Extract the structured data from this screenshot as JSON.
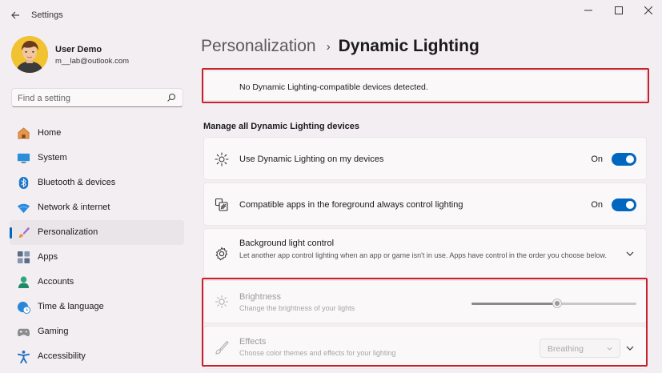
{
  "window": {
    "title": "Settings",
    "back_icon": "back-arrow-icon",
    "controls": [
      "minimize-icon",
      "maximize-icon",
      "close-icon"
    ]
  },
  "profile": {
    "name": "User Demo",
    "email": "m__lab@outlook.com"
  },
  "search": {
    "placeholder": "Find a setting",
    "icon": "search-icon"
  },
  "sidebar": {
    "items": [
      {
        "label": "Home",
        "icon": "home-icon",
        "active": false
      },
      {
        "label": "System",
        "icon": "system-icon",
        "active": false
      },
      {
        "label": "Bluetooth & devices",
        "icon": "bluetooth-icon",
        "active": false
      },
      {
        "label": "Network & internet",
        "icon": "network-icon",
        "active": false
      },
      {
        "label": "Personalization",
        "icon": "brush-icon",
        "active": true
      },
      {
        "label": "Apps",
        "icon": "apps-icon",
        "active": false
      },
      {
        "label": "Accounts",
        "icon": "accounts-icon",
        "active": false
      },
      {
        "label": "Time & language",
        "icon": "globe-clock-icon",
        "active": false
      },
      {
        "label": "Gaming",
        "icon": "gamepad-icon",
        "active": false
      },
      {
        "label": "Accessibility",
        "icon": "accessibility-icon",
        "active": false
      }
    ]
  },
  "breadcrumb": {
    "parent": "Personalization",
    "separator": "›",
    "current": "Dynamic Lighting"
  },
  "notice": {
    "text": "No Dynamic Lighting-compatible devices detected."
  },
  "section": {
    "title": "Manage all Dynamic Lighting devices"
  },
  "settings": {
    "use_dynamic_lighting": {
      "title": "Use Dynamic Lighting on my devices",
      "state_label": "On",
      "on": true,
      "icon": "lighting-icon"
    },
    "foreground_apps": {
      "title": "Compatible apps in the foreground always control lighting",
      "state_label": "On",
      "on": true,
      "icon": "apps-control-icon"
    },
    "background_control": {
      "title": "Background light control",
      "description": "Let another app control lighting when an app or game isn't in use. Apps have control in the order you choose below.",
      "icon": "gear-icon"
    },
    "brightness": {
      "title": "Brightness",
      "description": "Change the brightness of your lights",
      "value_percent": 52,
      "icon": "brightness-icon"
    },
    "effects": {
      "title": "Effects",
      "description": "Choose color themes and effects for your lighting",
      "selected": "Breathing",
      "icon": "paintbrush-icon"
    }
  },
  "colors": {
    "accent": "#0067c0",
    "highlight": "#c8202d",
    "background": "#f3eef2",
    "card": "#fbf8fa"
  }
}
